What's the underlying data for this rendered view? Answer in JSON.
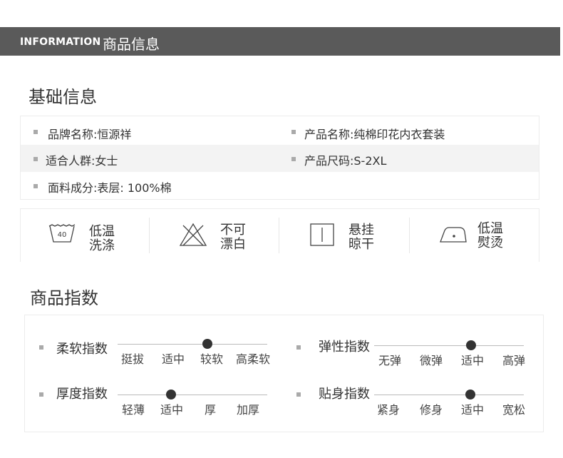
{
  "header": {
    "en": "INFORMATION",
    "cn": "商品信息"
  },
  "basic": {
    "title": "基础信息",
    "rows": [
      {
        "left": "品牌名称:恒源祥",
        "right": "产品名称:纯棉印花内衣套装"
      },
      {
        "left": "适合人群:女士",
        "right": "产品尺码:S-2XL"
      },
      {
        "left": "面料成分:表层: 100%棉",
        "right": ""
      }
    ]
  },
  "care": [
    {
      "icon": "wash-40-icon",
      "label": [
        "低温",
        "洗涤"
      ],
      "wash_temp": "40"
    },
    {
      "icon": "no-bleach-icon",
      "label": [
        "不可",
        "漂白"
      ]
    },
    {
      "icon": "hang-dry-icon",
      "label": [
        "悬挂",
        "晾干"
      ]
    },
    {
      "icon": "iron-low-icon",
      "label": [
        "低温",
        "熨烫"
      ]
    }
  ],
  "index": {
    "title": "商品指数",
    "items": [
      {
        "name": "柔软指数",
        "ticks": [
          "挺拔",
          "适中",
          "较软",
          "高柔软"
        ],
        "selected": 2
      },
      {
        "name": "弹性指数",
        "ticks": [
          "无弹",
          "微弹",
          "适中",
          "高弹"
        ],
        "selected": 2
      },
      {
        "name": "厚度指数",
        "ticks": [
          "轻薄",
          "适中",
          "厚",
          "加厚"
        ],
        "selected": 1
      },
      {
        "name": "贴身指数",
        "ticks": [
          "紧身",
          "修身",
          "适中",
          "宽松"
        ],
        "selected": 2
      }
    ]
  }
}
